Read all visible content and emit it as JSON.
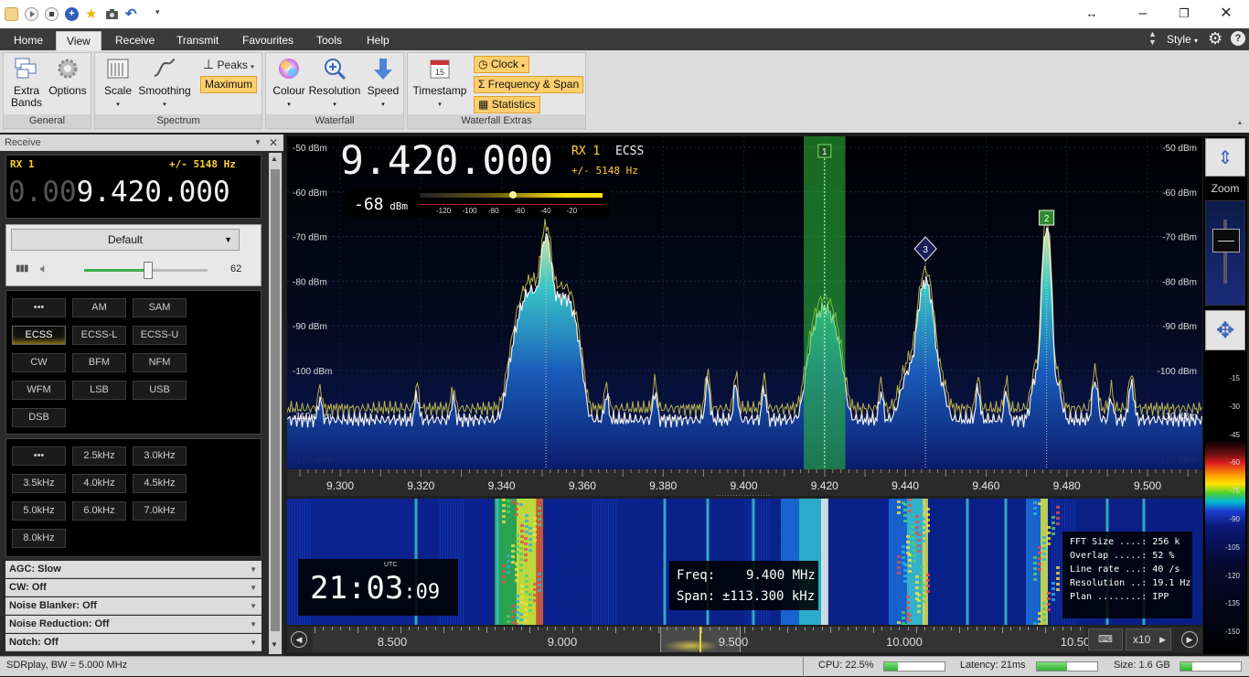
{
  "menu": {
    "tabs": [
      "Home",
      "View",
      "Receive",
      "Transmit",
      "Favourites",
      "Tools",
      "Help"
    ],
    "active": "View",
    "style_label": "Style"
  },
  "ribbon": {
    "general": {
      "label": "General",
      "extra_bands": "Extra\nBands",
      "options": "Options"
    },
    "spectrum": {
      "label": "Spectrum",
      "scale": "Scale",
      "smoothing": "Smoothing",
      "peaks": "Peaks",
      "maximum": "Maximum"
    },
    "waterfall": {
      "label": "Waterfall",
      "colour": "Colour",
      "resolution": "Resolution",
      "speed": "Speed"
    },
    "extras": {
      "label": "Waterfall Extras",
      "timestamp": "Timestamp",
      "clock": "Clock",
      "freq_span": "Frequency & Span",
      "statistics": "Statistics"
    }
  },
  "receive_panel": {
    "title": "Receive",
    "rx_label": "RX 1",
    "bandwidth": "+/- 5148 Hz",
    "freq_dim": "0.00",
    "freq_bright": "9.420.000",
    "preset": "Default",
    "volume": "62",
    "volume_fraction": 0.62,
    "modes": [
      "•••",
      "AM",
      "SAM",
      "ECSS",
      "ECSS-L",
      "ECSS-U",
      "CW",
      "BFM",
      "NFM",
      "WFM",
      "LSB",
      "USB",
      "DSB"
    ],
    "active_mode": "ECSS",
    "filters": [
      "•••",
      "2.5kHz",
      "3.0kHz",
      "3.5kHz",
      "4.0kHz",
      "4.5kHz",
      "5.0kHz",
      "6.0kHz",
      "7.0kHz",
      "8.0kHz"
    ],
    "options": [
      "AGC: Slow",
      "CW: Off",
      "Noise Blanker: Off",
      "Noise Reduction: Off",
      "Notch: Off"
    ]
  },
  "spectrum_view": {
    "frequency": "9.420.000",
    "rx_label": "RX 1",
    "mode": "ECSS",
    "bandwidth": "+/- 5148 Hz",
    "signal": "-68",
    "signal_unit": "dBm",
    "meter_ticks": [
      "-120",
      "-100",
      "-80",
      "-60",
      "-40",
      "-20"
    ],
    "db_labels": [
      "-50 dBm",
      "-60 dBm",
      "-70 dBm",
      "-80 dBm",
      "-90 dBm",
      "-100 dBm",
      "-110 dBm",
      "-120 dBm"
    ],
    "freq_ticks": [
      "9.300",
      "9.320",
      "9.340",
      "9.360",
      "9.380",
      "9.400",
      "9.420",
      "9.440",
      "9.460",
      "9.480",
      "9.500"
    ],
    "markers": [
      "1",
      "2",
      "3"
    ]
  },
  "waterfall_view": {
    "clock_hm": "21:03",
    "clock_s": ":09",
    "utc": "UTC",
    "freq_label": "Freq:",
    "freq_value": "9.400 MHz",
    "span_label": "Span:",
    "span_value": "±113.300 kHz",
    "stats": [
      "FFT Size ....: 256 k",
      "Overlap .....: 52 %",
      "Line rate ...: 40 /s",
      "Resolution ..: 19.1 Hz",
      "Plan ........: IPP"
    ]
  },
  "right_bar": {
    "zoom": "Zoom",
    "scale": [
      "-15",
      "-30",
      "-45",
      "-60",
      "-75",
      "-90",
      "-105",
      "-120",
      "-135",
      "-150"
    ]
  },
  "bottom_scale": {
    "ticks": [
      "8.500",
      "9.000",
      "9.500",
      "10.000",
      "10.50"
    ],
    "zoom": "x10"
  },
  "status": {
    "device": "SDRplay, BW = 5.000 MHz",
    "cpu": "CPU: 22.5%",
    "cpu_fraction": 0.225,
    "latency": "Latency: 21ms",
    "size": "Size: 1.6 GB"
  }
}
